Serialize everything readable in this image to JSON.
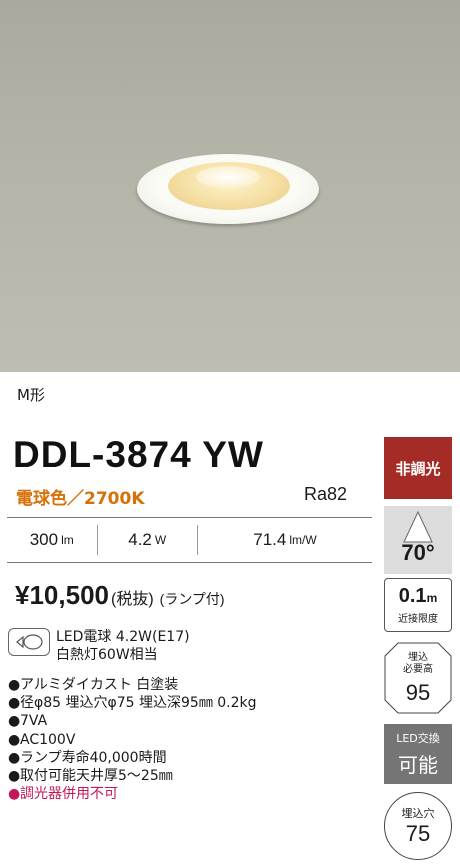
{
  "shape_label": "M形",
  "model": "DDL-3874 YW",
  "color_temp": "電球色／2700K",
  "ra": "Ra82",
  "specs": [
    {
      "value": "300",
      "unit": "lm"
    },
    {
      "value": "4.2",
      "unit": "W"
    },
    {
      "value": "71.4",
      "unit": "lm/W"
    }
  ],
  "price": {
    "amount": "¥10,500",
    "tax": "(税抜)",
    "lamp": "(ランプ付)"
  },
  "bulb": {
    "line1": "LED電球 4.2W(E17)",
    "line2": "白熱灯60W相当"
  },
  "features": [
    "アルミダイカスト 白塗装",
    "径φ85 埋込穴φ75 埋込深95㎜ 0.2kg",
    "7VA",
    "AC100V",
    "ランプ寿命40,000時間",
    "取付可能天井厚5～25㎜"
  ],
  "warning": "調光器併用不可",
  "badges": {
    "dimming": "非調光",
    "beam_angle": "70°",
    "min_height_value": "0.1",
    "min_height_unit": "m",
    "min_height_label": "近接限度",
    "embed_height_label_1": "埋込",
    "embed_height_label_2": "必要高",
    "embed_height_value": "95",
    "led_swap_label": "LED交換",
    "led_swap_value": "可能",
    "hole_label": "埋込穴",
    "hole_value": "75"
  },
  "colors": {
    "accent_orange": "#d8700a",
    "dim_red": "#a42b26",
    "warn_pink": "#c2185b",
    "led_gray": "#757575"
  }
}
